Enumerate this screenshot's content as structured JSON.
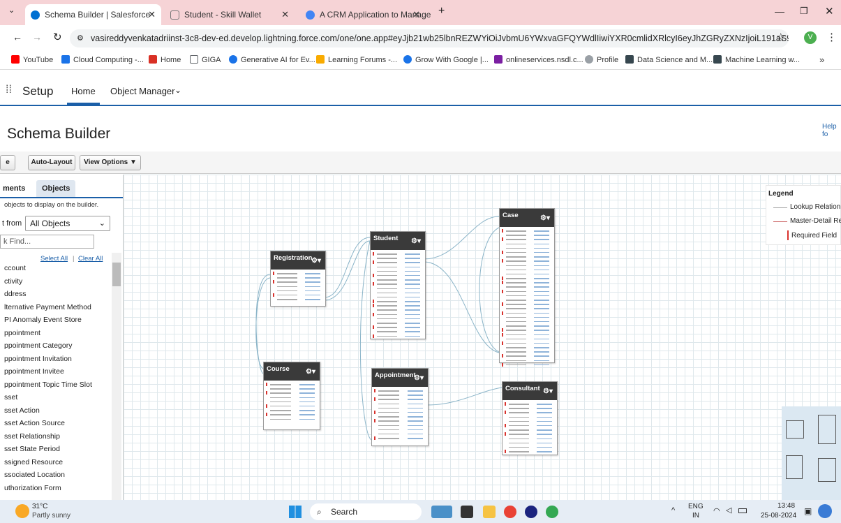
{
  "browser": {
    "tabs": [
      {
        "title": "Schema Builder | Salesforce",
        "color": "#0070d2"
      },
      {
        "title": "Student - Skill Wallet",
        "color": "#9aa0a6"
      },
      {
        "title": "A CRM Application to Manage",
        "color": "#4285f4"
      }
    ],
    "url": "vasireddyvenkatadriinst-3c8-dev-ed.develop.lightning.force.com/one/one.app#eyJjb21wb25lbnREZWYiOiJvbmU6YWxvaGFQYWdlIiwiYXR0cmlidXRlcyI6eyJhZGRyZXNzIjoiL191aS9wbGF0Zm9...",
    "avatar_letter": "V",
    "bookmarks": [
      {
        "label": "YouTube",
        "color": "#ff0000"
      },
      {
        "label": "Cloud Computing -...",
        "color": "#1a73e8"
      },
      {
        "label": "Home",
        "color": "#d93025"
      },
      {
        "label": "GIGA",
        "color": "#5f6368"
      },
      {
        "label": "Generative AI for Ev...",
        "color": "#1a73e8"
      },
      {
        "label": "Learning Forums -...",
        "color": "#f9ab00"
      },
      {
        "label": "Grow With Google |...",
        "color": "#1a73e8"
      },
      {
        "label": "onlineservices.nsdl.c...",
        "color": "#7b1fa2"
      },
      {
        "label": "Profile",
        "color": "#9aa0a6"
      },
      {
        "label": "Data Science and M...",
        "color": "#37474f"
      },
      {
        "label": "Machine Learning w...",
        "color": "#37474f"
      }
    ],
    "more_bookmarks": "»"
  },
  "sf_nav": {
    "app": "Setup",
    "tabs": [
      "Home",
      "Object Manager"
    ]
  },
  "page": {
    "title": "Schema Builder",
    "help": "Help fo"
  },
  "toolbar": {
    "cut_btn": "e",
    "auto_layout": "Auto-Layout",
    "view_options": "View Options ▼"
  },
  "sidebar": {
    "tabs": [
      "ments",
      "Objects"
    ],
    "hint": "objects to display on the builder.",
    "select_label": "t from",
    "select_value": "All Objects",
    "find_placeholder": "k Find...",
    "select_all": "Select All",
    "separator": "|",
    "clear_all": "Clear All",
    "objects": [
      "ccount",
      "ctivity",
      "ddress",
      "lternative Payment Method",
      "PI Anomaly Event Store",
      "ppointment",
      "ppointment Category",
      "ppointment Invitation",
      "ppointment Invitee",
      "ppointment Topic Time Slot",
      "sset",
      "sset Action",
      "sset Action Source",
      "sset Relationship",
      "sset State Period",
      "ssigned Resource",
      "ssociated Location",
      "uthorization Form"
    ]
  },
  "objects": [
    {
      "name": "Registration",
      "fields": 7
    },
    {
      "name": "Student",
      "fields": 20
    },
    {
      "name": "Case",
      "fields": 32
    },
    {
      "name": "Course",
      "fields": 9
    },
    {
      "name": "Appointment",
      "fields": 12
    },
    {
      "name": "Consultant",
      "fields": 12
    }
  ],
  "legend": {
    "title": "Legend",
    "lookup": "Lookup Relation",
    "master": "Master-Detail Re",
    "required": "Required Field"
  },
  "taskbar": {
    "temp": "31°C",
    "weather": "Partly sunny",
    "search": "Search",
    "lang": "ENG",
    "region": "IN",
    "time": "13:48",
    "date": "25-08-2024"
  }
}
